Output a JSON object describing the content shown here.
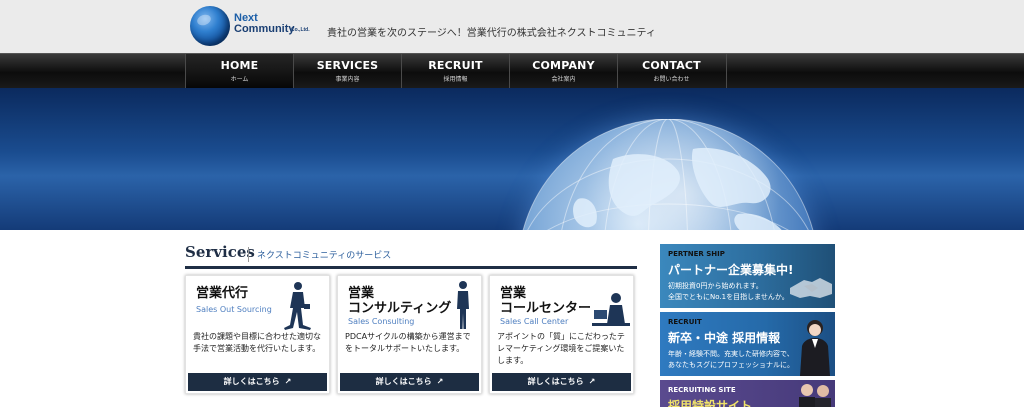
{
  "header": {
    "logo_line1": "Next",
    "logo_line2": "Community",
    "logo_suffix": "Co.,Ltd.",
    "tagline": "貴社の営業を次のステージへ！営業代行の株式会社ネクストコミュニティ"
  },
  "nav": {
    "items": [
      {
        "label": "HOME",
        "sub": "ホーム"
      },
      {
        "label": "SERVICES",
        "sub": "事業内容"
      },
      {
        "label": "RECRUIT",
        "sub": "採用情報"
      },
      {
        "label": "COMPANY",
        "sub": "会社案内"
      },
      {
        "label": "CONTACT",
        "sub": "お問い合わせ"
      }
    ]
  },
  "services": {
    "title": "Services",
    "subtitle": "ネクストコミュニティのサービス",
    "cards": [
      {
        "title": "営業代行",
        "en": "Sales Out Sourcing",
        "desc": "貴社の課題や目標に合わせた適切な手法で営業活動を代行いたします。",
        "button": "詳しくはこちら"
      },
      {
        "title": "営業\nコンサルティング",
        "en": "Sales Consulting",
        "desc": "PDCAサイクルの構築から運営までをトータルサポートいたします。",
        "button": "詳しくはこちら"
      },
      {
        "title": "営業\nコールセンター",
        "en": "Sales Call Center",
        "desc": "アポイントの「質」にこだわったテレマーケティング環境をご提案いたします。",
        "button": "詳しくはこちら"
      }
    ]
  },
  "banners": [
    {
      "label": "PERTNER SHIP",
      "title": "パートナー企業募集中!",
      "desc_line1": "初期投資0円から始めれます。",
      "desc_line2": "全国でともにNo.1を目指しませんか。"
    },
    {
      "label": "RECRUIT",
      "title": "新卒・中途 採用情報",
      "desc_line1": "年齢・経験不問。充実した研修内容で、",
      "desc_line2": "あなたもスグにプロフェッショナルに。"
    },
    {
      "label": "RECRUITING SITE",
      "title": "採用特設サイト"
    }
  ],
  "colors": {
    "nav_bg": "#0c0c0c",
    "hero_blue": "#1a4c8f",
    "button_navy": "#1d2d42",
    "banner_blue": "#2f6fa3",
    "banner_purple": "#4a3d80"
  }
}
